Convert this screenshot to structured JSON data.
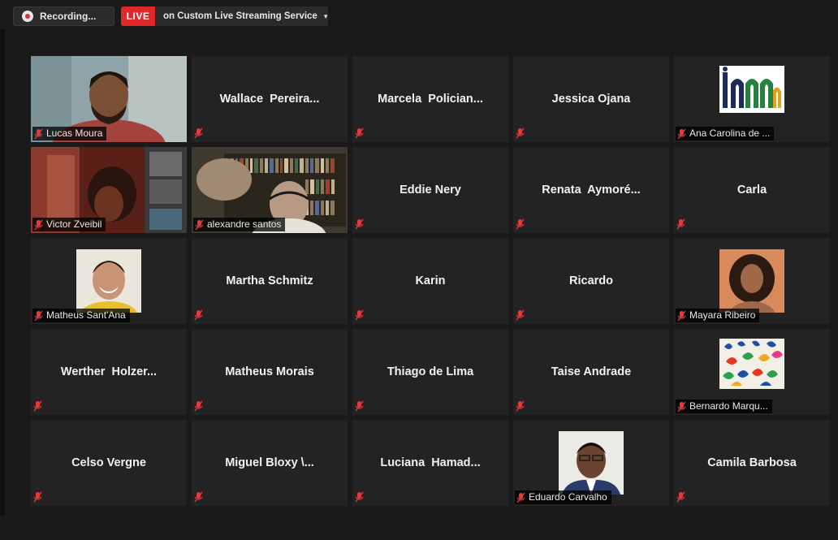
{
  "topbar": {
    "recording_label": "Recording...",
    "live_badge": "LIVE",
    "live_service": "on Custom Live Streaming Service",
    "caret": "▾"
  },
  "colors": {
    "background": "#1a1a1a",
    "tile": "#232323",
    "live_red": "#e02828",
    "active_speaker_border": "#d9e07a",
    "muted_mic": "#e23b3b"
  },
  "participants": [
    {
      "name": "Lucas Moura",
      "display": "video",
      "muted": true
    },
    {
      "name": "Wallace  Pereira...",
      "display": "name",
      "muted": true
    },
    {
      "name": "Marcela  Polician...",
      "display": "name",
      "muted": true
    },
    {
      "name": "Jessica Ojana",
      "display": "name",
      "muted": true
    },
    {
      "name": "Ana Carolina de ...",
      "display": "logo",
      "muted": true
    },
    {
      "name": "Victor Zveibil",
      "display": "video",
      "muted": true
    },
    {
      "name": "alexandre santos",
      "display": "video",
      "muted": true,
      "active": true
    },
    {
      "name": "Eddie Nery",
      "display": "name",
      "muted": true
    },
    {
      "name": "Renata  Aymoré...",
      "display": "name",
      "muted": true
    },
    {
      "name": "Carla",
      "display": "name",
      "muted": true
    },
    {
      "name": "Matheus Sant'Ana",
      "display": "photo",
      "muted": true
    },
    {
      "name": "Martha Schmitz",
      "display": "name",
      "muted": true
    },
    {
      "name": "Karin",
      "display": "name",
      "muted": true
    },
    {
      "name": "Ricardo",
      "display": "name",
      "muted": true
    },
    {
      "name": "Mayara Ribeiro",
      "display": "photo",
      "muted": true
    },
    {
      "name": "Werther  Holzer...",
      "display": "name",
      "muted": true
    },
    {
      "name": "Matheus Morais",
      "display": "name",
      "muted": true
    },
    {
      "name": "Thiago de Lima",
      "display": "name",
      "muted": true
    },
    {
      "name": "Taise Andrade",
      "display": "name",
      "muted": true
    },
    {
      "name": "Bernardo Marqu...",
      "display": "photo",
      "muted": true
    },
    {
      "name": "Celso Vergne",
      "display": "name",
      "muted": true
    },
    {
      "name": "Miguel Bloxy \\...",
      "display": "name",
      "muted": true
    },
    {
      "name": "Luciana  Hamad...",
      "display": "name",
      "muted": true
    },
    {
      "name": "Eduardo Carvalho",
      "display": "photo",
      "muted": true
    },
    {
      "name": "Camila Barbosa",
      "display": "name",
      "muted": true
    }
  ]
}
